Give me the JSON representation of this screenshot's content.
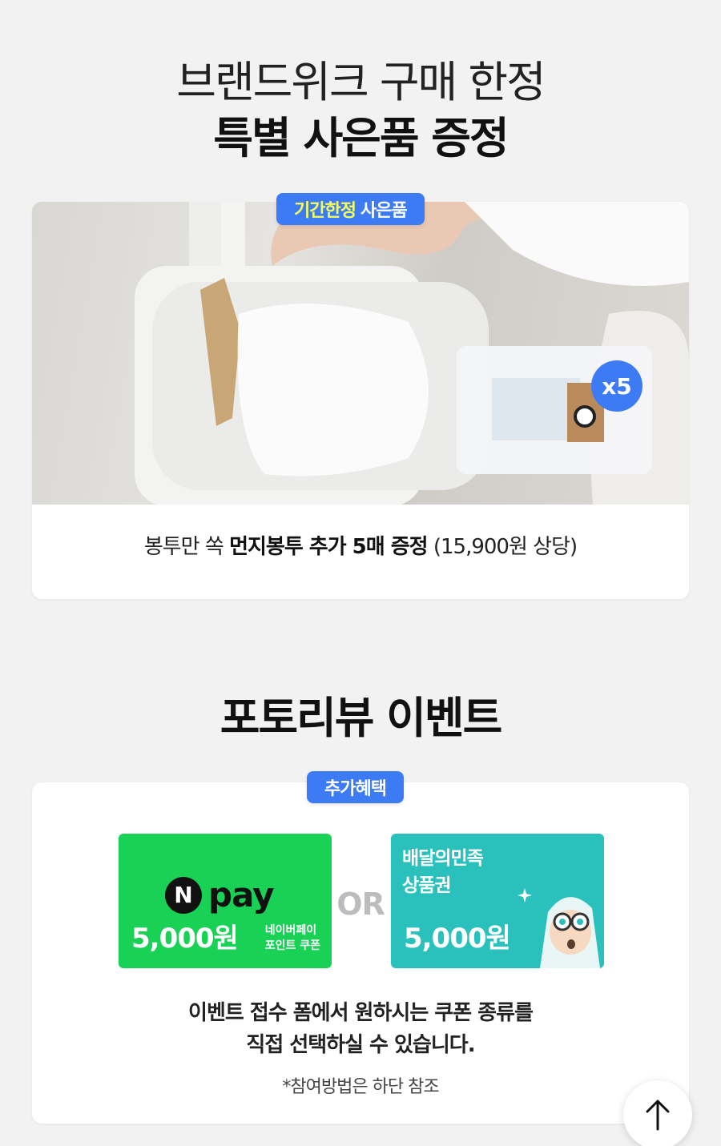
{
  "header": {
    "line1": "브랜드위크 구매 한정",
    "line2": "특별 사은품 증정"
  },
  "gift": {
    "badge_highlight": "기간한정",
    "badge_text": "사은품",
    "quantity_badge": "x5",
    "caption_prefix": "봉투만 쏙 ",
    "caption_bold": "먼지봉투 추가 5매 증정",
    "caption_suffix": " (15,900원 상당)"
  },
  "review": {
    "title": "포토리뷰 이벤트",
    "badge": "추가혜택",
    "or_label": "OR",
    "npay": {
      "logo_n": "N",
      "logo_text": "pay",
      "amount": "5,000원",
      "desc_line1": "네이버페이",
      "desc_line2": "포인트 쿠폰"
    },
    "baemin": {
      "title_line1": "배달의민족",
      "title_line2": "상품권",
      "amount": "5,000원"
    },
    "desc_line1": "이벤트 접수 폼에서 원하시는 쿠폰 종류를",
    "desc_line2": "직접 선택하실 수 있습니다.",
    "note": "*참여방법은 하단 참조"
  },
  "colors": {
    "accent_blue": "#3d7bf5",
    "npay_green": "#19d155",
    "baemin_teal": "#2ac1bc",
    "badge_highlight_yellow": "#f5ff5a"
  },
  "icons": {
    "scroll_top": "arrow-up-icon"
  }
}
